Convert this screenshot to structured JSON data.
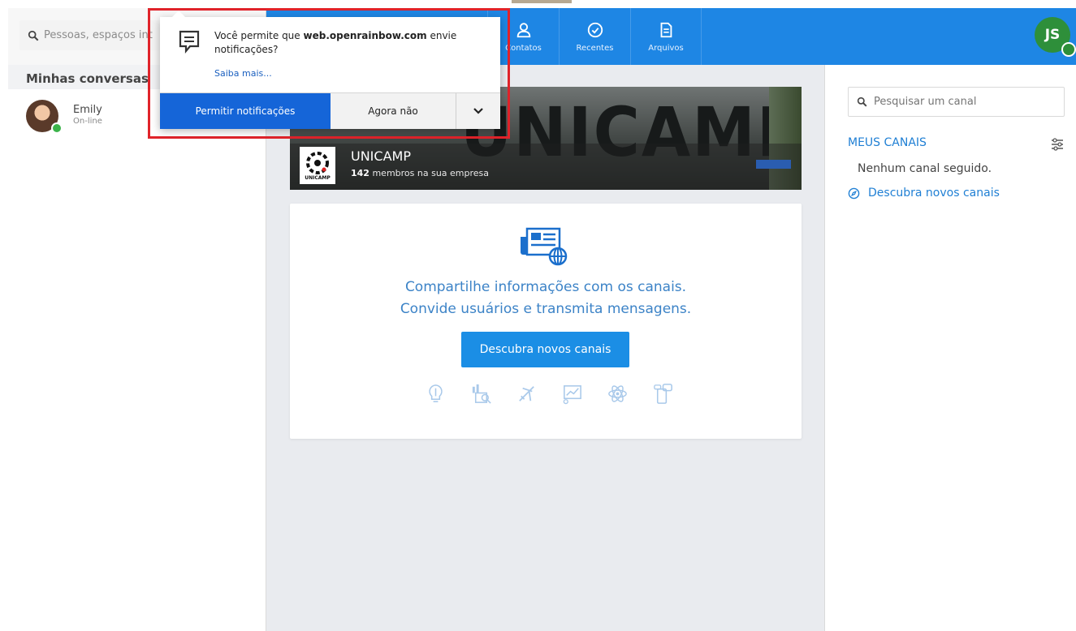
{
  "topbar": {
    "search_placeholder": "Pessoas, espaços int",
    "nav": [
      {
        "label": "Contatos",
        "icon": "person-icon"
      },
      {
        "label": "Recentes",
        "icon": "clock-icon"
      },
      {
        "label": "Arquivos",
        "icon": "document-icon"
      }
    ],
    "user_initials": "JS"
  },
  "left": {
    "heading": "Minhas conversas",
    "contact": {
      "name": "Emily",
      "status": "On-line"
    }
  },
  "banner": {
    "background_text": "UNICAMP",
    "logo_text": "UNICAMP",
    "title": "UNICAMP",
    "members_count": "142",
    "members_text": "membros na sua empresa"
  },
  "card": {
    "line1": "Compartilhe informações com os canais.",
    "line2": "Convide usuários e transmita mensagens.",
    "button": "Descubra novos canais"
  },
  "right": {
    "search_placeholder": "Pesquisar um canal",
    "my_channels": "MEUS CANAIS",
    "none": "Nenhum canal seguido.",
    "discover": "Descubra novos canais"
  },
  "popup": {
    "msg_prefix": "Você permite que",
    "site": "web.openrainbow.com",
    "msg_suffix": "envie notificações?",
    "learn_more": "Saiba mais...",
    "allow": "Permitir notificações",
    "later": "Agora não"
  },
  "colors": {
    "topbar": "#1e86e4",
    "accent": "#1f7fd4",
    "highlight": "#e0232a",
    "online": "#3bb34a"
  }
}
